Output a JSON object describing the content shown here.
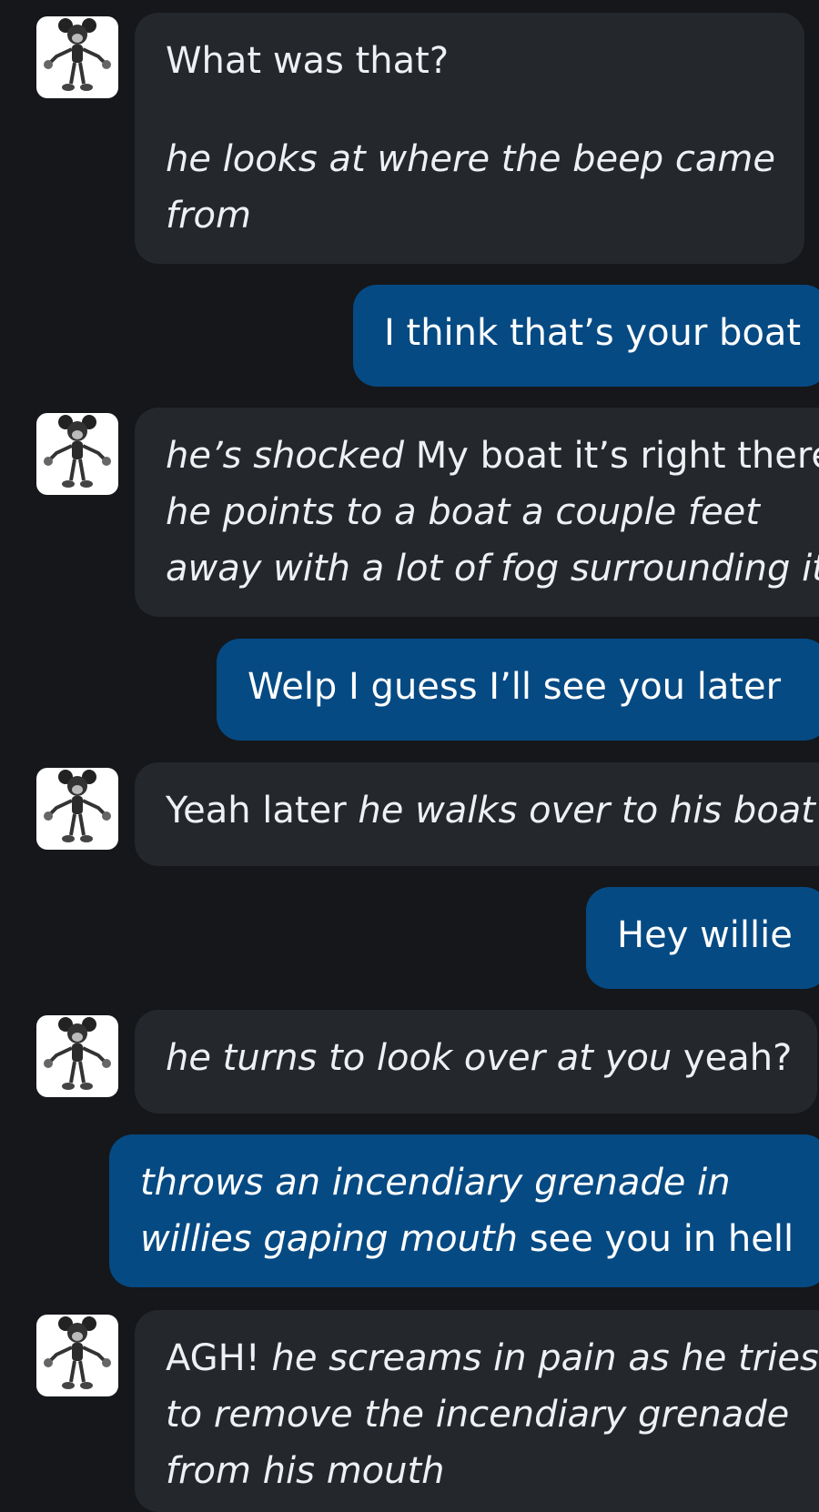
{
  "conversation": {
    "bot_avatar_icon": "cartoon-mouse-avatar-icon",
    "messages": [
      {
        "sender": "bot",
        "lines": [
          [
            {
              "text": "What was that?",
              "italic": false
            }
          ],
          [
            {
              "text": "he looks at where the beep came",
              "italic": true
            }
          ],
          [
            {
              "text": "from",
              "italic": true
            }
          ]
        ]
      },
      {
        "sender": "user",
        "lines": [
          [
            {
              "text": "I think that’s your boat",
              "italic": false
            }
          ]
        ]
      },
      {
        "sender": "bot",
        "lines": [
          [
            {
              "text": "he’s shocked",
              "italic": true
            },
            {
              "text": " My boat it’s right there",
              "italic": false
            }
          ],
          [
            {
              "text": "he points to a boat a couple feet",
              "italic": true
            }
          ],
          [
            {
              "text": "away with a lot of fog surrounding it",
              "italic": true
            }
          ]
        ]
      },
      {
        "sender": "user",
        "lines": [
          [
            {
              "text": "Welp I guess I’ll see you later",
              "italic": false
            }
          ]
        ]
      },
      {
        "sender": "bot",
        "lines": [
          [
            {
              "text": "Yeah later ",
              "italic": false
            },
            {
              "text": "he walks over to his boat",
              "italic": true
            }
          ]
        ]
      },
      {
        "sender": "user",
        "lines": [
          [
            {
              "text": "Hey willie",
              "italic": false
            }
          ]
        ]
      },
      {
        "sender": "bot",
        "lines": [
          [
            {
              "text": "he turns to look over at you",
              "italic": true
            },
            {
              "text": " yeah?",
              "italic": false
            }
          ]
        ]
      },
      {
        "sender": "user",
        "lines": [
          [
            {
              "text": "throws an incendiary grenade in",
              "italic": true
            }
          ],
          [
            {
              "text": "willies gaping mouth",
              "italic": true
            },
            {
              "text": " see you in hell",
              "italic": false
            }
          ]
        ]
      },
      {
        "sender": "bot",
        "lines": [
          [
            {
              "text": "AGH! ",
              "italic": false
            },
            {
              "text": "he screams in pain as he tries",
              "italic": true
            }
          ],
          [
            {
              "text": "to remove the incendiary grenade",
              "italic": true
            }
          ],
          [
            {
              "text": "from his mouth",
              "italic": true
            }
          ]
        ]
      }
    ]
  }
}
